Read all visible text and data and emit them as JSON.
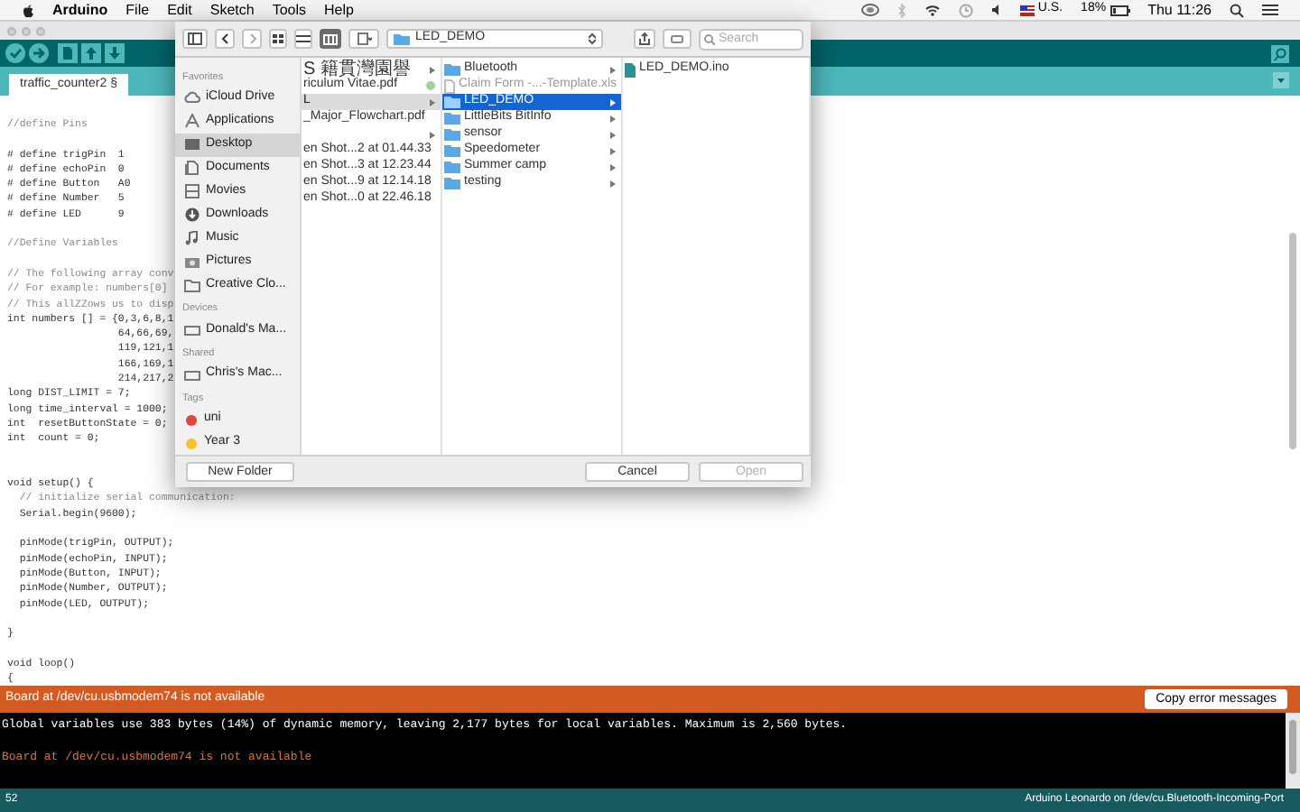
{
  "menu_bar": {
    "app": "Arduino",
    "items": [
      "File",
      "Edit",
      "Sketch",
      "Tools",
      "Help"
    ],
    "keyboard": "U.S.",
    "battery": "18%",
    "clock": "Thu 11:26"
  },
  "tab": {
    "label": "traffic_counter2 §"
  },
  "code_lines": [
    {
      "kind": "comment",
      "text": "//define Pins"
    },
    {
      "kind": "blank"
    },
    {
      "kind": "code",
      "text": "# define trigPin  1"
    },
    {
      "kind": "code",
      "text": "# define echoPin  0"
    },
    {
      "kind": "code",
      "text": "# define Button   A0"
    },
    {
      "kind": "code",
      "text": "# define Number   5"
    },
    {
      "kind": "code",
      "text": "# define LED      9"
    },
    {
      "kind": "blank"
    },
    {
      "kind": "comment",
      "text": "//Define Variables"
    },
    {
      "kind": "blank"
    },
    {
      "kind": "comment",
      "text": "// The following array conv"
    },
    {
      "kind": "comment",
      "text": "// For example: numbers[0]"
    },
    {
      "kind": "comment",
      "text": "// This allZZows us to disp"
    },
    {
      "kind": "code",
      "text": "int numbers [] = {0,3,6,8,1"
    },
    {
      "kind": "code",
      "text": "                  64,66,69,"
    },
    {
      "kind": "code",
      "text": "                  119,121,1"
    },
    {
      "kind": "code",
      "text": "                  166,169,1"
    },
    {
      "kind": "code",
      "text": "                  214,217,2"
    },
    {
      "kind": "code",
      "text": "long DIST_LIMIT = 7;"
    },
    {
      "kind": "code",
      "text": "long time_interval = 1000;"
    },
    {
      "kind": "code",
      "text": "int  resetButtonState = 0;"
    },
    {
      "kind": "code",
      "text": "int  count = 0;"
    },
    {
      "kind": "blank"
    },
    {
      "kind": "blank"
    },
    {
      "kind": "code",
      "text": "void setup() {"
    },
    {
      "kind": "comment",
      "text": "  // initialize serial communication:"
    },
    {
      "kind": "code",
      "text": "  Serial.begin(9600);"
    },
    {
      "kind": "blank"
    },
    {
      "kind": "code",
      "text": "  pinMode(trigPin, OUTPUT);"
    },
    {
      "kind": "code",
      "text": "  pinMode(echoPin, INPUT);"
    },
    {
      "kind": "code",
      "text": "  pinMode(Button, INPUT);"
    },
    {
      "kind": "code",
      "text": "  pinMode(Number, OUTPUT);"
    },
    {
      "kind": "code",
      "text": "  pinMode(LED, OUTPUT);"
    },
    {
      "kind": "blank"
    },
    {
      "kind": "code",
      "text": "}"
    },
    {
      "kind": "blank"
    },
    {
      "kind": "code",
      "text": "void loop()"
    },
    {
      "kind": "code",
      "text": "{"
    }
  ],
  "status_message": "Board at /dev/cu.usbmodem74 is not available",
  "copy_button": "Copy error messages",
  "console": [
    {
      "kind": "info",
      "text": "Global variables use 383 bytes (14%) of dynamic memory, leaving 2,177 bytes for local variables. Maximum is 2,560 bytes."
    },
    {
      "kind": "blank"
    },
    {
      "kind": "error",
      "text": "Board at /dev/cu.usbmodem74 is not available"
    }
  ],
  "footer": {
    "line": "52",
    "board": "Arduino Leonardo on /dev/cu.Bluetooth-Incoming-Port"
  },
  "dialog": {
    "path": "LED_DEMO",
    "search_placeholder": "Search",
    "sidebar": [
      {
        "kind": "header",
        "label": "Favorites"
      },
      {
        "kind": "item",
        "label": "iCloud Drive",
        "selected": false
      },
      {
        "kind": "item",
        "label": "Applications",
        "selected": false
      },
      {
        "kind": "item",
        "label": "Desktop",
        "selected": true
      },
      {
        "kind": "item",
        "label": "Documents",
        "selected": false
      },
      {
        "kind": "item",
        "label": "Movies",
        "selected": false
      },
      {
        "kind": "item",
        "label": "Downloads",
        "selected": false
      },
      {
        "kind": "item",
        "label": "Music",
        "selected": false
      },
      {
        "kind": "item",
        "label": "Pictures",
        "selected": false
      },
      {
        "kind": "item",
        "label": "Creative Clo...",
        "selected": false
      },
      {
        "kind": "header",
        "label": "Devices"
      },
      {
        "kind": "device",
        "label": "Donald's Ma...",
        "selected": false
      },
      {
        "kind": "header",
        "label": "Shared"
      },
      {
        "kind": "device",
        "label": "Chris's Mac...",
        "selected": false
      },
      {
        "kind": "header",
        "label": "Tags"
      },
      {
        "kind": "tag",
        "label": "uni",
        "color": "#e0443c"
      },
      {
        "kind": "tag",
        "label": "Year 3",
        "color": "#f5c12e"
      }
    ],
    "columns": [
      {
        "focused": false,
        "items": [
          {
            "kind": "folder",
            "label": "S 籍貫灣園譽",
            "selected": false
          },
          {
            "kind": "file",
            "label": "riculum Vitae.pdf",
            "color": "#9ed39a",
            "selected": false
          },
          {
            "kind": "folder",
            "label": "L",
            "selected": true
          },
          {
            "kind": "file",
            "label": "_Major_Flowchart.pdf",
            "selected": false
          },
          {
            "kind": "folder",
            "selected": false
          },
          {
            "kind": "file",
            "label": "en Shot...2 at 01.44.33",
            "selected": false
          },
          {
            "kind": "file",
            "label": "en Shot...3 at 12.23.44",
            "selected": false
          },
          {
            "kind": "file",
            "label": "en Shot...9 at 12.14.18",
            "selected": false
          },
          {
            "kind": "file",
            "label": "en Shot...0 at 22.46.18",
            "selected": false
          }
        ]
      },
      {
        "focused": true,
        "items": [
          {
            "kind": "folder",
            "label": "Bluetooth",
            "selected": false
          },
          {
            "kind": "file",
            "label": "Claim Form -...-Template.xls",
            "selected": false
          },
          {
            "kind": "folder",
            "label": "LED_DEMO",
            "selected": true
          },
          {
            "kind": "folder",
            "label": "LittleBits BitInfo",
            "selected": false
          },
          {
            "kind": "folder",
            "label": "sensor",
            "selected": false
          },
          {
            "kind": "folder",
            "label": "Speedometer",
            "selected": false
          },
          {
            "kind": "folder",
            "label": "Summer camp",
            "selected": false
          },
          {
            "kind": "folder",
            "label": "testing",
            "selected": false
          }
        ]
      },
      {
        "items": [
          {
            "kind": "sketch",
            "label": "LED_DEMO.ino",
            "selected": false
          }
        ]
      }
    ],
    "buttons": [
      {
        "kind": "new_folder",
        "label": "New Folder",
        "disabled": false
      },
      {
        "kind": "cancel",
        "label": "Cancel",
        "disabled": false
      },
      {
        "kind": "open",
        "label": "Open",
        "disabled": true
      }
    ]
  }
}
